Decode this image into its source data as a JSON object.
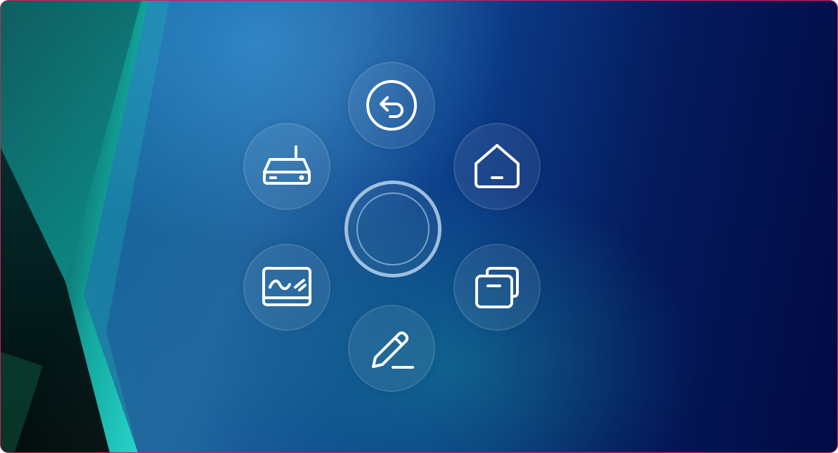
{
  "screen": {
    "frame_border_color": "#c8264f",
    "background_colors": [
      "#1a6f9c",
      "#0b3a86",
      "#020a44",
      "#19d3c5"
    ]
  },
  "radial_menu": {
    "center": {
      "icon": "circle-ring-icon"
    },
    "items": [
      {
        "id": "back",
        "icon": "back-arrow-icon"
      },
      {
        "id": "home",
        "icon": "home-icon"
      },
      {
        "id": "multitask",
        "icon": "windows-stack-icon"
      },
      {
        "id": "annotate",
        "icon": "pen-icon"
      },
      {
        "id": "whiteboard",
        "icon": "whiteboard-icon"
      },
      {
        "id": "source",
        "icon": "router-icon"
      }
    ],
    "icon_color": "#ffffff"
  }
}
